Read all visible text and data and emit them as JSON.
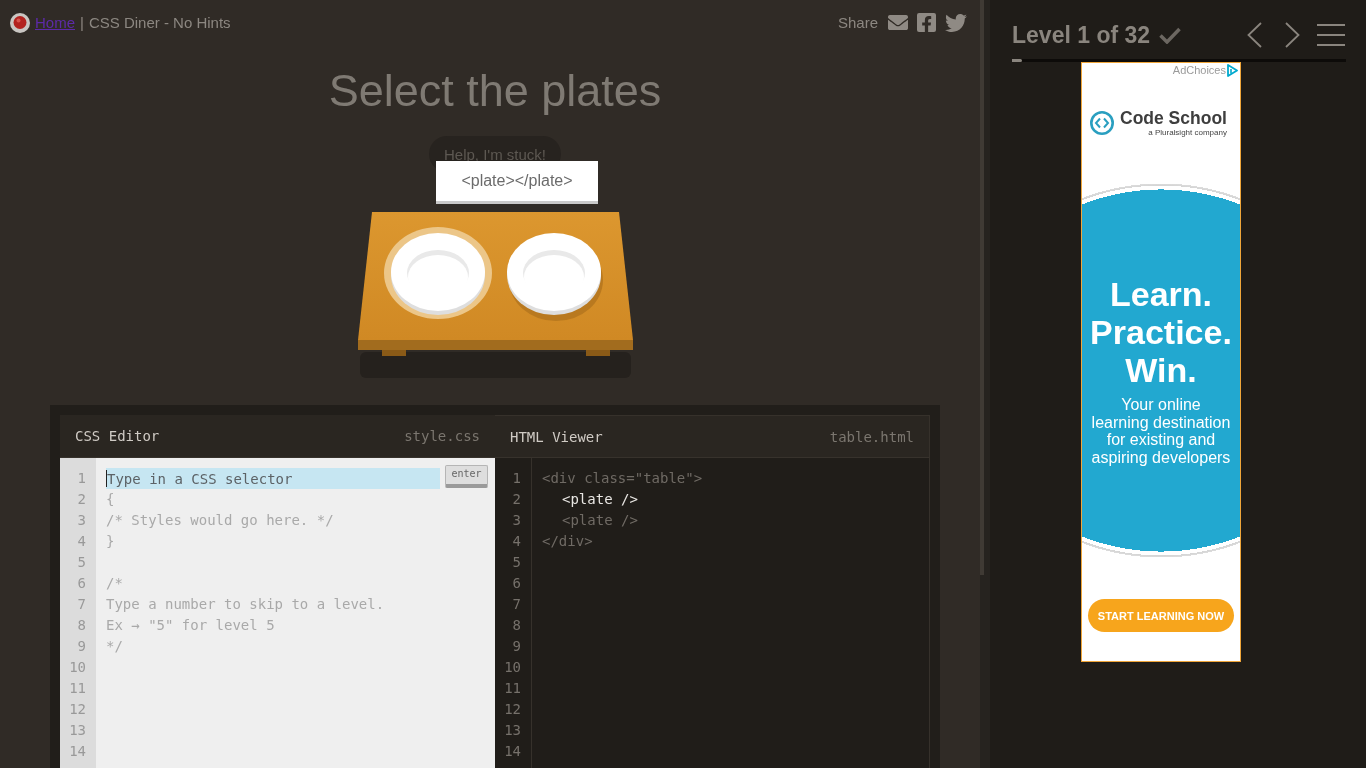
{
  "header": {
    "home_link": "Home",
    "separator": "|",
    "title": "CSS Diner - No Hints",
    "share_label": "Share"
  },
  "level_title": "Select the plates",
  "help_button": "Help, I'm stuck!",
  "tooltip": "<plate></plate>",
  "table": {
    "plates": [
      {
        "hovered": true
      },
      {
        "hovered": false
      }
    ]
  },
  "css_editor": {
    "title": "CSS Editor",
    "filename": "style.css",
    "line_numbers": [
      "1",
      "2",
      "3",
      "4",
      "5",
      "6",
      "7",
      "8",
      "9",
      "10",
      "11",
      "12",
      "13",
      "14"
    ],
    "input": {
      "placeholder": "Type in a CSS selector",
      "focused": true
    },
    "enter_button": "enter",
    "lines": [
      {
        "kind": "code",
        "text": "{"
      },
      {
        "kind": "code",
        "text": "/* Styles would go here. */"
      },
      {
        "kind": "code",
        "text": "}"
      },
      {
        "kind": "blank"
      },
      {
        "kind": "code",
        "text": "/*"
      },
      {
        "kind": "code",
        "text": "Type a number to skip to a level."
      },
      {
        "kind": "code",
        "text": "Ex → \"5\" for level 5"
      },
      {
        "kind": "code",
        "text": "*/"
      }
    ]
  },
  "html_viewer": {
    "title": "HTML Viewer",
    "filename": "table.html",
    "line_numbers": [
      "1",
      "2",
      "3",
      "4",
      "5",
      "6",
      "7",
      "8",
      "9",
      "10",
      "11",
      "12",
      "13",
      "14"
    ],
    "markup": {
      "open": "<div class=\"table\">",
      "close": "</div>",
      "highlighted": false,
      "children": [
        {
          "text": "<plate />",
          "highlighted": true
        },
        {
          "text": "<plate />",
          "highlighted": false
        }
      ]
    }
  },
  "level_panel": {
    "title": "Level 1 of 32",
    "completed": false,
    "progress": {
      "level": 0.03
    }
  },
  "ad": {
    "adchoices": "AdChoices",
    "brand": "Code School",
    "brand_tagline": "a Pluralsight company",
    "headline": [
      "Learn.",
      "Practice.",
      "Win."
    ],
    "body_lines": [
      "Your online",
      "learning destination",
      "for existing and",
      "aspiring developers"
    ],
    "button": "START LEARNING NOW"
  }
}
